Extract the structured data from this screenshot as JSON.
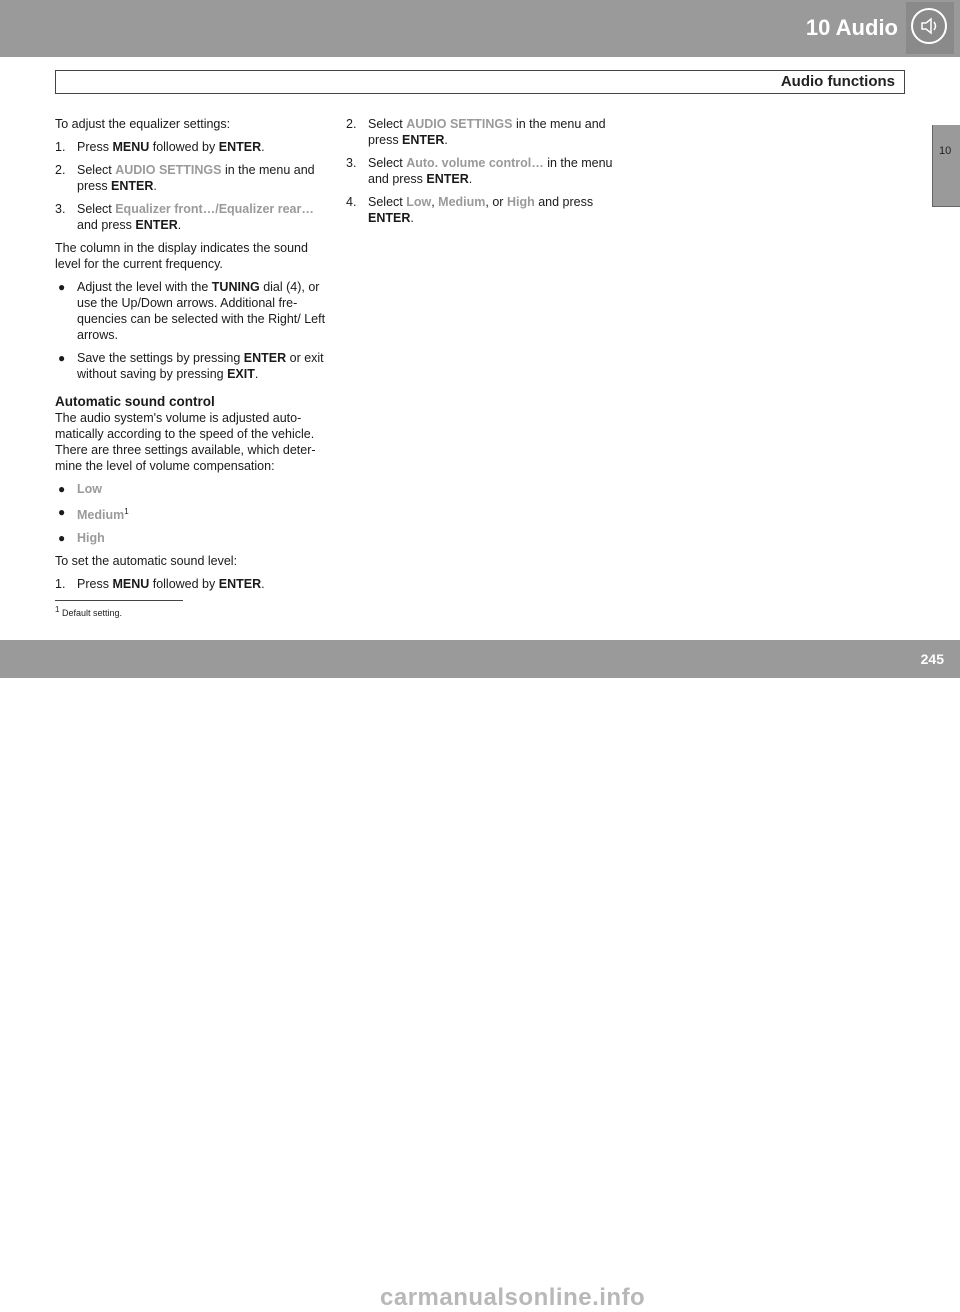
{
  "header": {
    "chapter": "10 Audio",
    "section": "Audio functions",
    "tab_number": "10"
  },
  "left": {
    "intro": "To adjust the equalizer settings:",
    "step1": {
      "n": "1.",
      "a": "Press ",
      "menu": "MENU",
      "b": " followed by ",
      "enter": "ENTER",
      "c": "."
    },
    "step2": {
      "n": "2.",
      "a": "Select ",
      "item": "AUDIO SETTINGS",
      "b": " in the menu and press ",
      "enter": "ENTER",
      "c": "."
    },
    "step3": {
      "n": "3.",
      "a": "Select ",
      "item": "Equalizer front…/Equalizer rear…",
      "b": " and press ",
      "enter": "ENTER",
      "c": "."
    },
    "para1": "The column in the display indicates the sound level for the current frequency.",
    "bullet1": {
      "a": "Adjust the level with the ",
      "k": "TUNING",
      "b": " dial (4), or use the Up/Down arrows. Additional fre-quencies can be selected with the Right/ Left arrows."
    },
    "bullet2": {
      "a": "Save the settings by pressing ",
      "k1": "ENTER",
      "b": " or exit without saving by pressing ",
      "k2": "EXIT",
      "c": "."
    },
    "heading": "Automatic sound control",
    "para2": "The audio system's volume is adjusted auto-matically according to the speed of the vehicle. There are three settings available, which deter-mine the level of volume compensation:",
    "options": [
      "Low",
      "Medium",
      "High"
    ],
    "footnote_mark": "1",
    "para3": "To set the automatic sound level:",
    "step4": {
      "n": "1.",
      "a": "Press ",
      "menu": "MENU",
      "b": " followed by ",
      "enter": "ENTER",
      "c": "."
    }
  },
  "right": {
    "step1": {
      "n": "2.",
      "a": "Select ",
      "item": "AUDIO SETTINGS",
      "b": " in the menu and press ",
      "enter": "ENTER",
      "c": "."
    },
    "step2": {
      "n": "3.",
      "a": "Select ",
      "item": "Auto. volume control…",
      "b": " in the menu and press ",
      "enter": "ENTER",
      "c": "."
    },
    "step3": {
      "n": "4.",
      "a": "Select ",
      "low": "Low",
      "s1": ", ",
      "medium": "Medium",
      "s2": ", or ",
      "high": "High",
      "b": " and press ",
      "enter": "ENTER",
      "c": "."
    }
  },
  "footnote": {
    "mark": "1",
    "text": " Default setting."
  },
  "footer": {
    "page": "245",
    "watermark": "carmanualsonline.info"
  },
  "icons": {
    "chapter_icon": "speaker-icon"
  }
}
